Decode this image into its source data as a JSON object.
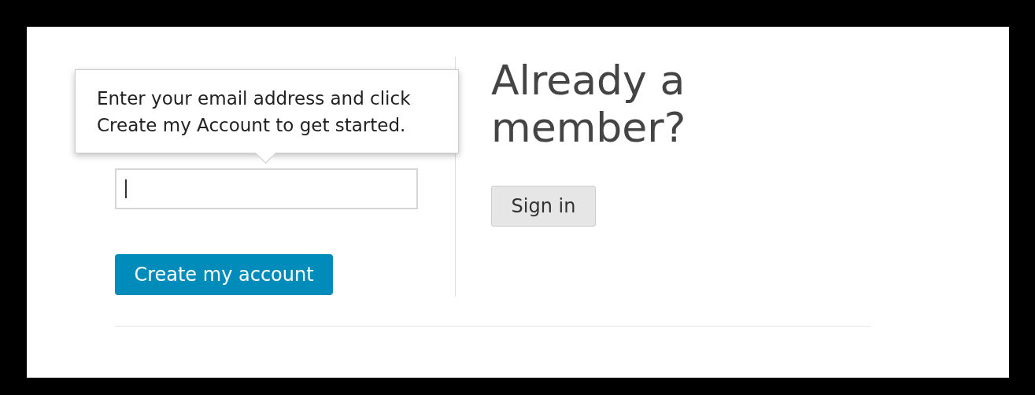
{
  "signup": {
    "create_button": "Create my account"
  },
  "tooltip": {
    "text": "Enter your email address and click Create my Account to get started."
  },
  "signin": {
    "heading": "Already a member?",
    "button": "Sign in"
  }
}
